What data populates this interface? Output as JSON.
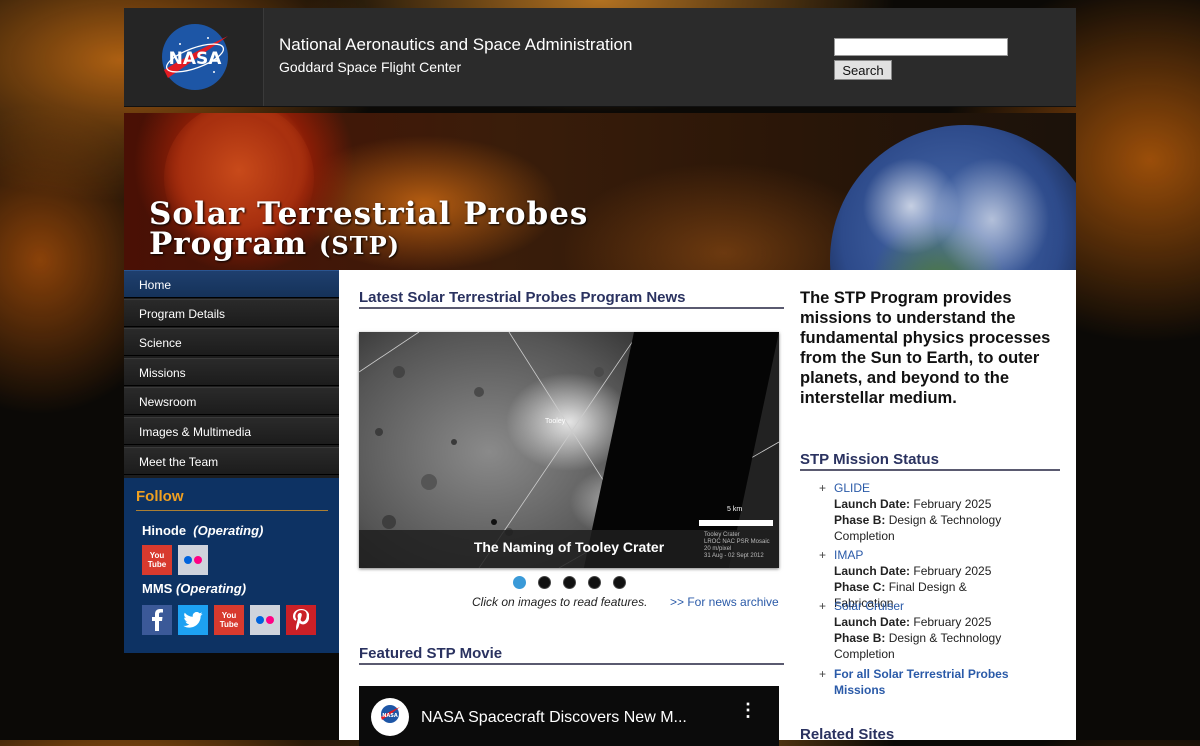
{
  "header": {
    "agency_name": "National Aeronautics and Space Administration",
    "center_name": "Goddard Space Flight Center",
    "logo_text": "NASA",
    "search_button": "Search",
    "search_value": ""
  },
  "banner": {
    "title_line1": "Solar Terrestrial Probes",
    "title_line2": "Program",
    "title_abbr": "(STP)"
  },
  "nav": {
    "items": [
      {
        "label": "Home",
        "active": true
      },
      {
        "label": "Program Details"
      },
      {
        "label": "Science"
      },
      {
        "label": "Missions"
      },
      {
        "label": "Newsroom"
      },
      {
        "label": "Images & Multimedia"
      },
      {
        "label": "Meet the Team"
      }
    ]
  },
  "follow": {
    "title": "Follow",
    "hinode": {
      "name": "Hinode",
      "status": "(Operating)",
      "icons": [
        "youtube-icon",
        "flickr-icon"
      ]
    },
    "mms": {
      "name": "MMS",
      "status": "(Operating)",
      "icons": [
        "facebook-icon",
        "twitter-icon",
        "youtube-icon",
        "flickr-icon",
        "pinterest-icon"
      ]
    },
    "youtube_text": "You Tube"
  },
  "news": {
    "title": "Latest Solar Terrestrial Probes Program News",
    "feature_caption": "The Naming of Tooley Crater",
    "crater_label": "Tooley",
    "scale_label": "5 km",
    "image_credit": [
      "Tooley Crater",
      "LROC NAC PSR Mosaic",
      "20 m/pixel",
      "31 Aug - 02 Sept 2012"
    ],
    "slide_count": 5,
    "active_slide": 0,
    "click_hint": "Click on images to read features.",
    "archive_link": ">> For news archive"
  },
  "movie": {
    "section_title": "Featured STP Movie",
    "video_title": "NASA Spacecraft Discovers New M...",
    "menu_glyph": "⋮"
  },
  "intro": {
    "text_before": "The ",
    "text_bold": "STP",
    "text_after": " Program provides missions to understand the fundamental physics processes from the Sun to Earth, to outer planets, and beyond to the interstellar medium."
  },
  "mission_status": {
    "title": "STP Mission Status",
    "items": [
      {
        "name": "GLIDE",
        "launch_label": "Launch Date:",
        "launch": "February 2025",
        "phase_label": "Phase B:",
        "phase": "Design & Technology Completion"
      },
      {
        "name": "IMAP",
        "launch_label": "Launch Date:",
        "launch": "February 2025",
        "phase_label": "Phase C:",
        "phase": "Final Design & Fabrication"
      },
      {
        "name": "Solar Cruiser",
        "launch_label": "Launch Date:",
        "launch": "February 2025",
        "phase_label": "Phase B:",
        "phase": "Design & Technology Completion"
      }
    ],
    "all_missions_link": "For all Solar Terrestrial Probes Missions",
    "plus_glyph": "+"
  },
  "related": {
    "title": "Related Sites"
  },
  "colors": {
    "accent": "#f0a020",
    "nav_active": "#1f3f6e",
    "link": "#2a5aa8",
    "follow_bg": "#0d3263"
  }
}
